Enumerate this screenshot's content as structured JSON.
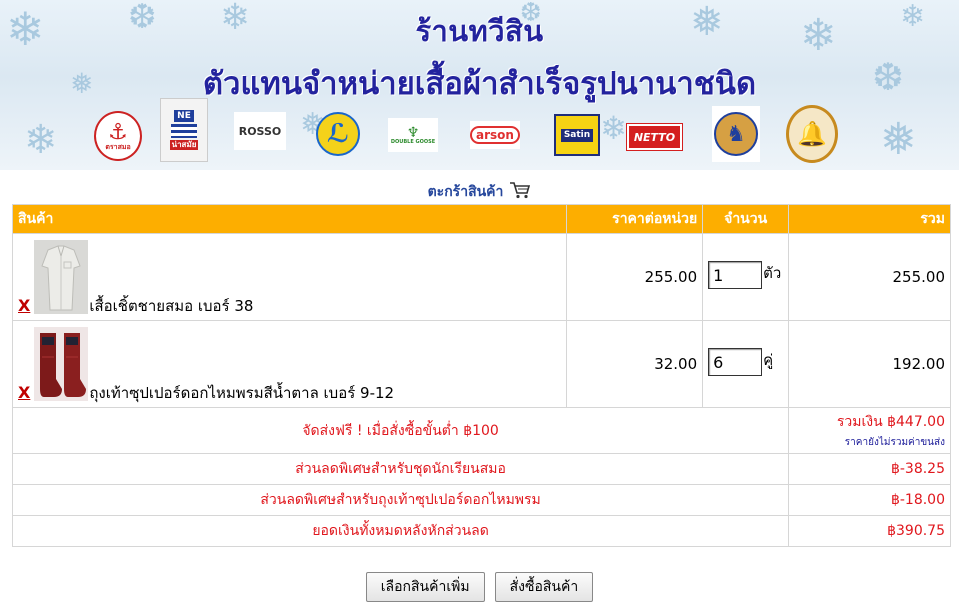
{
  "banner": {
    "shop_name": "ร้านทวีสิน",
    "tagline": "ตัวแทนจำหน่ายเสื้อผ้าสำเร็จรูปนานาชนิด",
    "brands": [
      {
        "icon": "anchor-brand-logo",
        "text": "ตราสมอ"
      },
      {
        "icon": "navy-brand-logo",
        "text": "น่าสมัย"
      },
      {
        "icon": "rosso-brand-logo",
        "text": "ROSSO"
      },
      {
        "icon": "swoosh-brand-logo",
        "text": ""
      },
      {
        "icon": "double-goose-brand-logo",
        "text": "DOUBLE GOOSE"
      },
      {
        "icon": "arson-brand-logo",
        "text": "arson"
      },
      {
        "icon": "satin-brand-logo",
        "text": "Satin"
      },
      {
        "icon": "netto-brand-logo",
        "text": "NETTO"
      },
      {
        "icon": "horse-brand-logo",
        "text": ""
      },
      {
        "icon": "bells-brand-logo",
        "text": ""
      }
    ]
  },
  "cart": {
    "title": "ตะกร้าสินค้า",
    "columns": {
      "product": "สินค้า",
      "unit_price": "ราคาต่อหน่วย",
      "quantity": "จำนวน",
      "total": "รวม"
    },
    "items": [
      {
        "remove": "X",
        "name": "เสื้อเชิ้ตชายสมอ เบอร์ 38",
        "unit_price": "255.00",
        "quantity": "1",
        "unit": "ตัว",
        "total": "255.00"
      },
      {
        "remove": "X",
        "name": "ถุงเท้าซุปเปอร์ดอกไหมพรมสีน้ำตาล เบอร์ 9-12",
        "unit_price": "32.00",
        "quantity": "6",
        "unit": "คู่",
        "total": "192.00"
      }
    ],
    "shipping_note": "จัดส่งฟรี ! เมื่อสั่งซื้อขั้นต่ำ ฿100",
    "subtotal": "รวมเงิน ฿447.00",
    "subtotal_note": "ราคายังไม่รวมค่าขนส่ง",
    "discounts": [
      {
        "label": "ส่วนลดพิเศษสำหรับชุดนักเรียนสมอ",
        "amount": "฿-38.25"
      },
      {
        "label": "ส่วนลดพิเศษสำหรับถุงเท้าซุปเปอร์ดอกไหมพรม",
        "amount": "฿-18.00"
      }
    ],
    "grand_total_label": "ยอดเงินทั้งหมดหลังหักส่วนลด",
    "grand_total": "฿390.75"
  },
  "buttons": {
    "continue_shopping": "เลือกสินค้าเพิ่ม",
    "checkout": "สั่งซื้อสินค้า"
  },
  "colors": {
    "header_bg": "#fdae00",
    "accent_red": "#e0171d",
    "title_blue": "#23239e"
  }
}
